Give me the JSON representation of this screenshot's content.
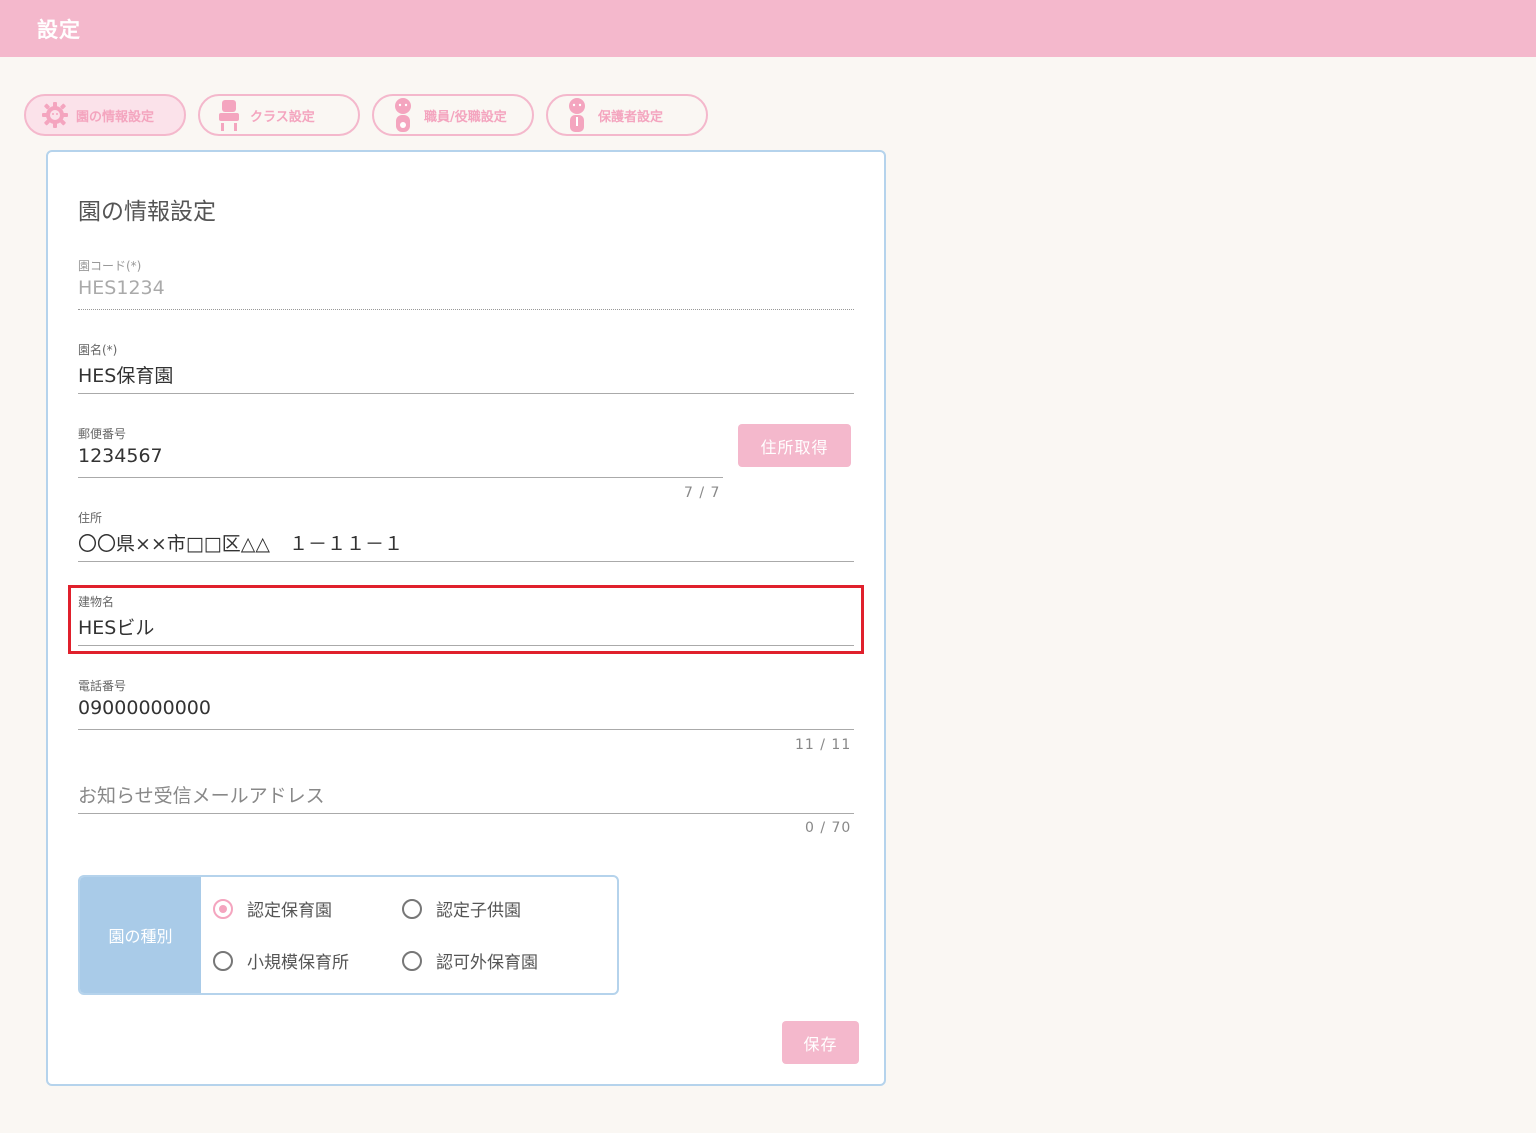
{
  "header": {
    "title": "設定"
  },
  "tabs": [
    {
      "label": "園の情報設定",
      "active": true
    },
    {
      "label": "クラス設定",
      "active": false
    },
    {
      "label": "職員/役職設定",
      "active": false
    },
    {
      "label": "保護者設定",
      "active": false
    }
  ],
  "form": {
    "title": "園の情報設定",
    "school_code": {
      "label": "園コード(*)",
      "value": "HES1234"
    },
    "school_name": {
      "label": "園名(*)",
      "value": "HES保育園"
    },
    "postal_code": {
      "label": "郵便番号",
      "value": "1234567",
      "counter": "7 / 7"
    },
    "address_button": "住所取得",
    "address": {
      "label": "住所",
      "value": "〇〇県××市□□区△△　１－１１－１"
    },
    "building": {
      "label": "建物名",
      "value": "HESビル"
    },
    "phone": {
      "label": "電話番号",
      "value": "09000000000",
      "counter": "11 / 11"
    },
    "email": {
      "placeholder": "お知らせ受信メールアドレス",
      "counter": "0 / 70"
    },
    "kind": {
      "label": "園の種別",
      "options": [
        {
          "label": "認定保育園",
          "checked": true
        },
        {
          "label": "認定子供園",
          "checked": false
        },
        {
          "label": "小規模保育所",
          "checked": false
        },
        {
          "label": "認可外保育園",
          "checked": false
        }
      ]
    },
    "save_button": "保存"
  },
  "colors": {
    "brand_pink": "#f4b8cc",
    "accent_blue": "#a9cbe8",
    "highlight_red": "#e0202c"
  }
}
